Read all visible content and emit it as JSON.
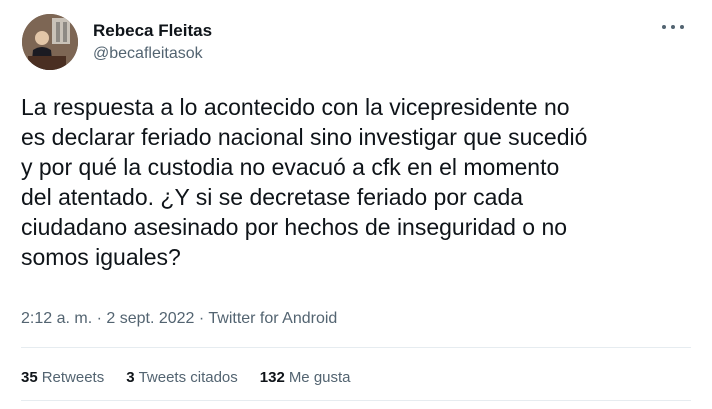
{
  "user": {
    "display_name": "Rebeca Fleitas",
    "handle": "@becafleitasok"
  },
  "tweet": {
    "text": "La respuesta a lo acontecido con la vicepresidente no\nes declarar feriado nacional sino investigar que sucedió\ny por qué la custodia no evacuó a cfk en el momento\ndel atentado. ¿Y si se decretase feriado por cada\nciudadano asesinado por hechos de inseguridad o no\nsomos iguales?",
    "meta": "2:12 a. m. · 2 sept. 2022 · Twitter for Android"
  },
  "stats": {
    "retweets_count": "35",
    "retweets_label": "Retweets",
    "quotes_count": "3",
    "quotes_label": "Tweets citados",
    "likes_count": "132",
    "likes_label": "Me gusta"
  },
  "icons": {
    "more": "more-horizontal-icon"
  },
  "colors": {
    "text_primary": "#0f1419",
    "text_secondary": "#536471",
    "divider": "#e6ecf0"
  }
}
